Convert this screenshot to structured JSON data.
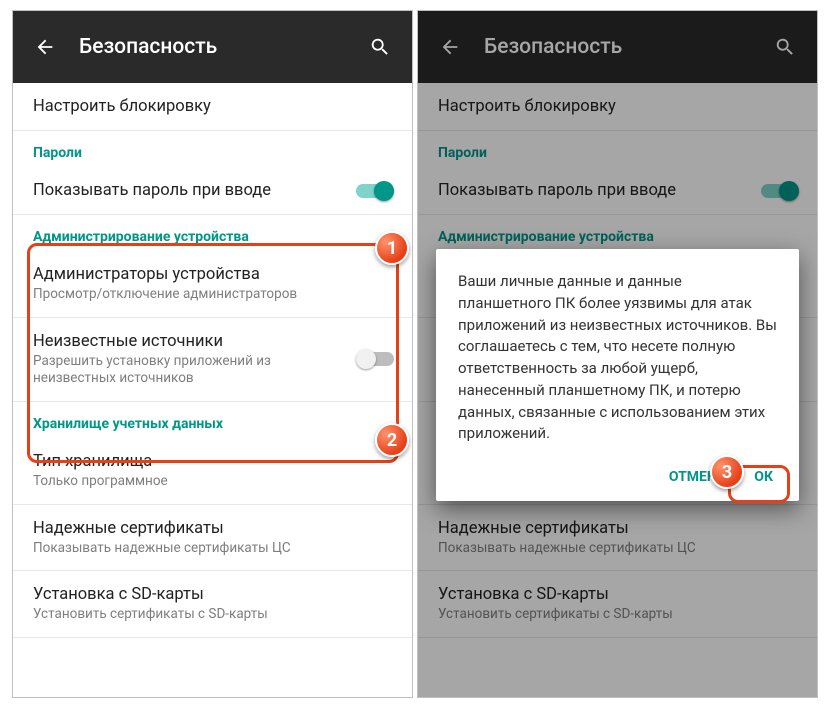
{
  "toolbar": {
    "title": "Безопасность"
  },
  "rows": {
    "configure_lock": {
      "title": "Настроить блокировку"
    },
    "sec_passwords": "Пароли",
    "show_password": {
      "title": "Показывать пароль при вводе"
    },
    "sec_admin": "Администрирование устройства",
    "device_admins": {
      "title": "Администраторы устройства",
      "sub": "Просмотр/отключение администраторов"
    },
    "unknown_sources": {
      "title": "Неизвестные источники",
      "sub": "Разрешить установку приложений из неизвестных источников"
    },
    "sec_creds": "Хранилище учетных данных",
    "storage_type": {
      "title": "Тип хранилища",
      "sub": "Только программное"
    },
    "trusted_certs": {
      "title": "Надежные сертификаты",
      "sub": "Показывать надежные сертификаты ЦС"
    },
    "install_sd": {
      "title": "Установка с SD-карты",
      "sub": "Установить сертификаты с SD-карты"
    }
  },
  "dialog": {
    "message": "Ваши личные данные и данные планшетного ПК более уязвимы для атак приложений из неизвестных источников. Вы соглашаетесь с тем, что несете полную ответственность за любой ущерб, нанесенный планшетному ПК, и потерю данных, связанные с использованием этих приложений.",
    "cancel": "Отмена",
    "ok": "ОК"
  },
  "badges": {
    "one": "1",
    "two": "2",
    "three": "3"
  }
}
